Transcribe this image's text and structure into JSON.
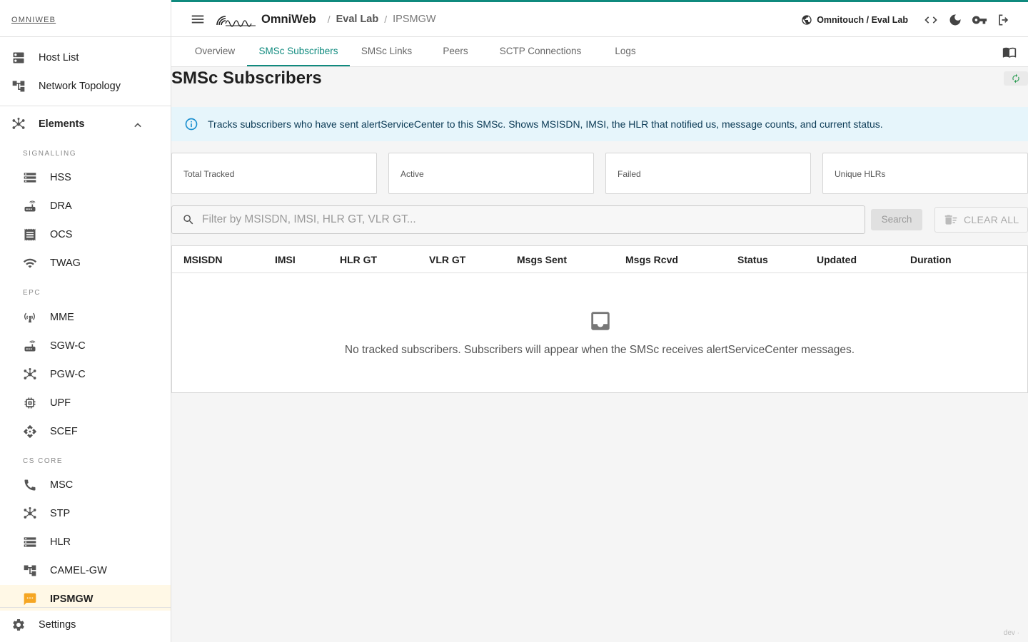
{
  "sidebar": {
    "logo": "OMNIWEB",
    "top_items": [
      {
        "label": "Host List",
        "icon": "dns-icon"
      },
      {
        "label": "Network Topology",
        "icon": "account-tree-icon"
      }
    ],
    "elements_label": "Elements",
    "sections": [
      {
        "title": "SIGNALLING",
        "items": [
          "HSS",
          "DRA",
          "OCS",
          "TWAG"
        ]
      },
      {
        "title": "EPC",
        "items": [
          "MME",
          "SGW-C",
          "PGW-C",
          "UPF",
          "SCEF"
        ]
      },
      {
        "title": "CS CORE",
        "items": [
          "MSC",
          "STP",
          "HLR",
          "CAMEL-GW",
          "IPSMGW"
        ]
      }
    ],
    "active_item": "IPSMGW",
    "settings_label": "Settings"
  },
  "header": {
    "brand": "OmniWeb",
    "breadcrumb": [
      "Eval Lab",
      "IPSMGW"
    ],
    "separator": "/",
    "tenant": "Omnitouch / Eval Lab"
  },
  "tabs": [
    "Overview",
    "SMSc Subscribers",
    "SMSc Links",
    "Peers",
    "SCTP Connections",
    "Logs"
  ],
  "active_tab": "SMSc Subscribers",
  "page": {
    "title": "SMSc Subscribers",
    "info": "Tracks subscribers who have sent alertServiceCenter to this SMSc. Shows MSISDN, IMSI, the HLR that notified us, message counts, and current status.",
    "stats": [
      "Total Tracked",
      "Active",
      "Failed",
      "Unique HLRs"
    ],
    "search_placeholder": "Filter by MSISDN, IMSI, HLR GT, VLR GT...",
    "search_button": "Search",
    "clear_button": "CLEAR ALL",
    "table_headers": [
      "MSISDN",
      "IMSI",
      "HLR GT",
      "VLR GT",
      "Msgs Sent",
      "Msgs Rcvd",
      "Status",
      "Updated",
      "Duration"
    ],
    "empty_message": "No tracked subscribers. Subscribers will appear when the SMSc receives alertServiceCenter messages."
  },
  "env_label": "dev ·",
  "colors": {
    "accent": "#0f8a7e",
    "info_bg": "#e6f5fb",
    "active_bg": "#fff8e6",
    "highlight": "#f5a623"
  }
}
